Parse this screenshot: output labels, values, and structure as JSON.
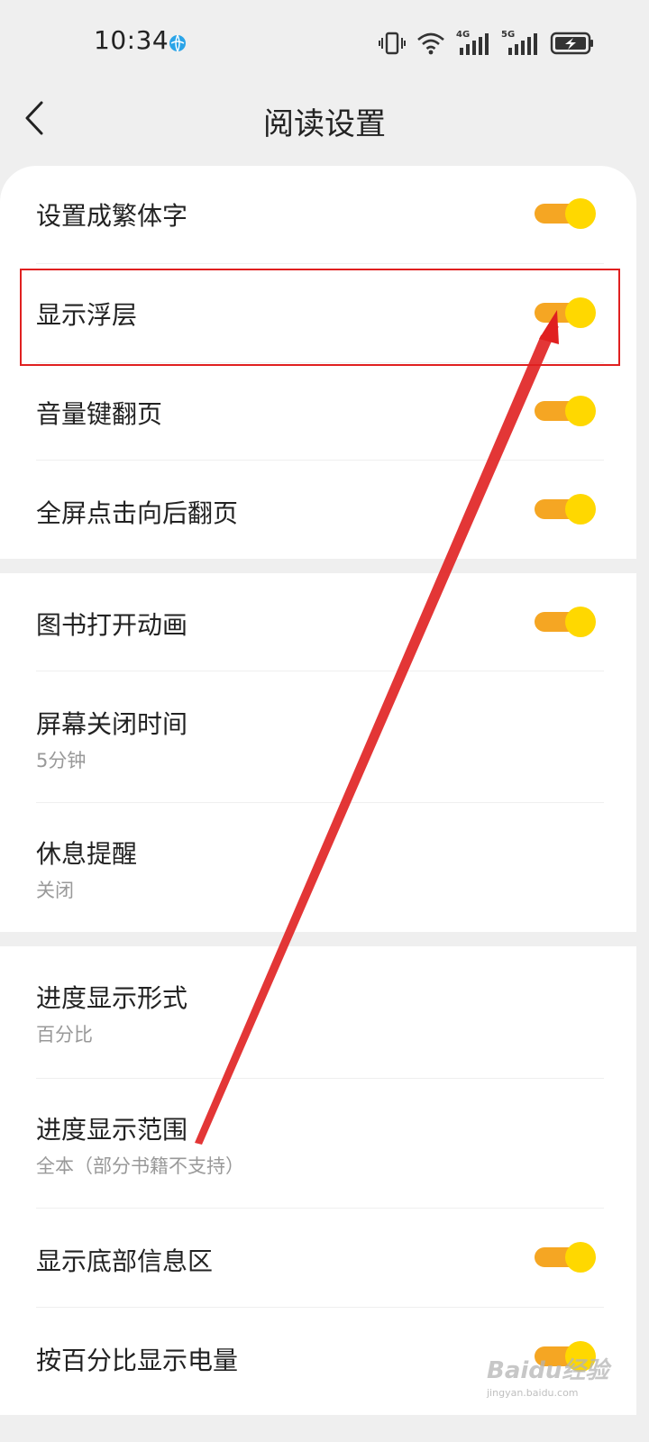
{
  "status_bar": {
    "time": "10:34",
    "network_1": "4G",
    "network_2": "5G"
  },
  "header": {
    "title": "阅读设置"
  },
  "sections": [
    {
      "items": [
        {
          "title": "设置成繁体字",
          "toggle": true
        },
        {
          "title": "显示浮层",
          "toggle": true
        },
        {
          "title": "音量键翻页",
          "toggle": true
        },
        {
          "title": "全屏点击向后翻页",
          "toggle": true
        }
      ]
    },
    {
      "items": [
        {
          "title": "图书打开动画",
          "toggle": true
        },
        {
          "title": "屏幕关闭时间",
          "subtitle": "5分钟"
        },
        {
          "title": "休息提醒",
          "subtitle": "关闭"
        }
      ]
    },
    {
      "items": [
        {
          "title": "进度显示形式",
          "subtitle": "百分比"
        },
        {
          "title": "进度显示范围",
          "subtitle": "全本（部分书籍不支持）"
        },
        {
          "title": "显示底部信息区",
          "toggle": true
        },
        {
          "title": "按百分比显示电量",
          "toggle": true
        }
      ]
    }
  ],
  "colors": {
    "toggle_track": "#f5a623",
    "toggle_knob": "#ffd800",
    "annotation": "#e02020"
  },
  "watermark": {
    "text": "Baidu经验",
    "subtext": "jingyan.baidu.com"
  }
}
